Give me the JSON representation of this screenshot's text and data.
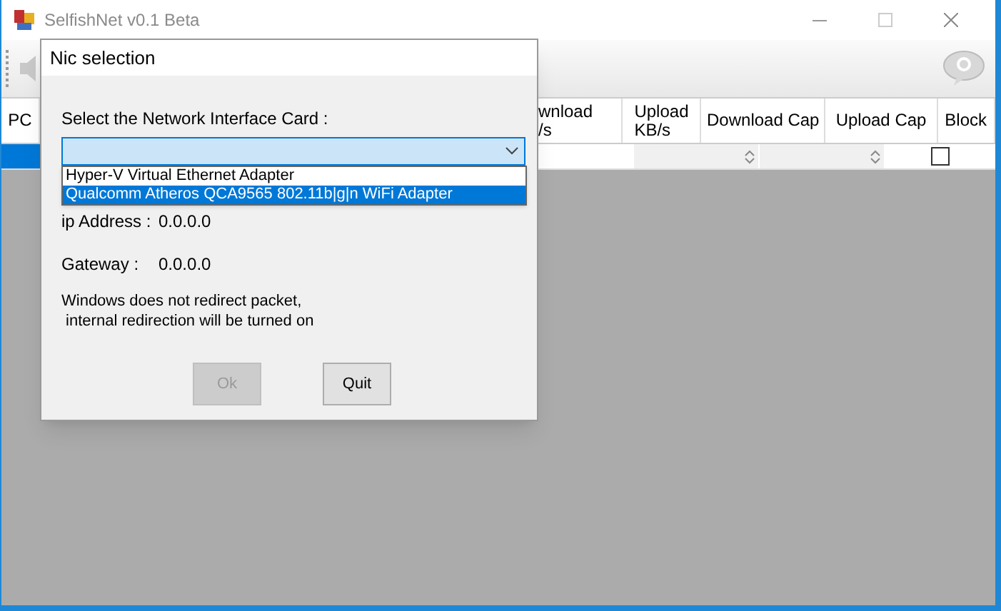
{
  "window": {
    "title": "SelfishNet v0.1 Beta"
  },
  "table": {
    "columns": [
      {
        "label": "PC"
      },
      {
        "label": "wnload\n/s"
      },
      {
        "label": "Upload\nKB/s"
      },
      {
        "label": "Download Cap"
      },
      {
        "label": "Upload Cap"
      },
      {
        "label": "Block"
      }
    ],
    "rows": [
      {
        "selected": true,
        "block": {
          "checked": false
        }
      }
    ]
  },
  "dialog": {
    "title": "Nic selection",
    "prompt": "Select the Network Interface Card :",
    "options": [
      {
        "label": "Hyper-V Virtual Ethernet Adapter",
        "selected": false
      },
      {
        "label": "Qualcomm Atheros QCA9565 802.11b|g|n WiFi Adapter",
        "selected": true
      }
    ],
    "fields": [
      {
        "label": "ip Address :",
        "value": "0.0.0.0"
      },
      {
        "label": "Gateway :",
        "value": "0.0.0.0"
      }
    ],
    "message": "Windows does not redirect packet,\n internal redirection will be turned on",
    "buttons": [
      {
        "label": "Ok",
        "disabled": true
      },
      {
        "label": "Quit",
        "disabled": false
      }
    ]
  }
}
